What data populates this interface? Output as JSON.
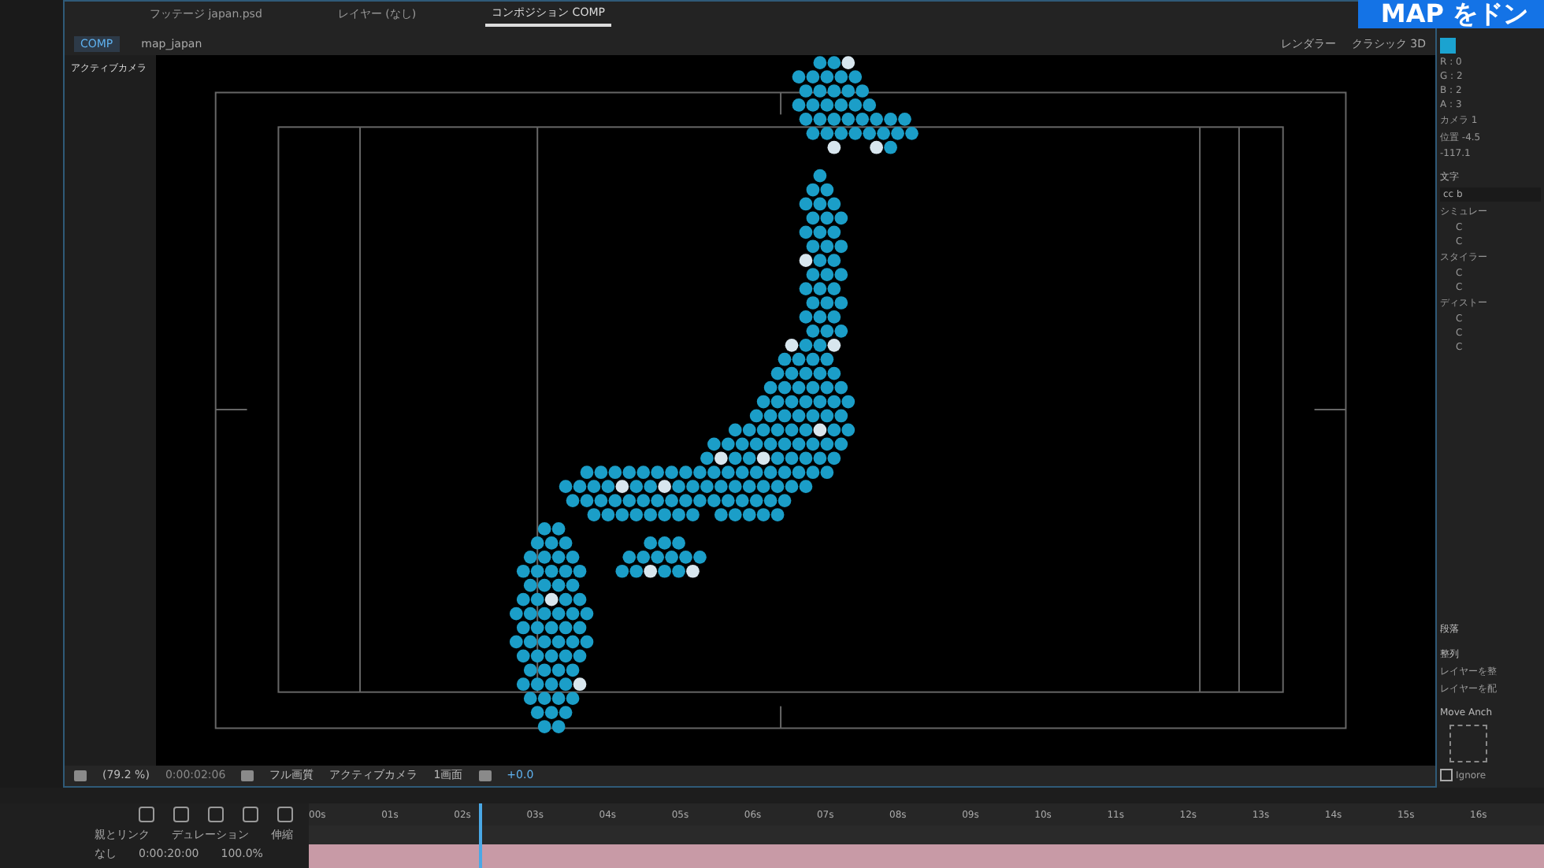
{
  "caption": "MAP をドン",
  "tabs": [
    {
      "label": "フッテージ japan.psd",
      "selected": false
    },
    {
      "label": "レイヤー (なし)",
      "selected": false
    },
    {
      "label": "コンポジション COMP",
      "selected": true
    }
  ],
  "breadcrumbs": [
    {
      "label": "COMP",
      "selected": true
    },
    {
      "label": "map_japan",
      "selected": false
    }
  ],
  "renderer": {
    "label": "レンダラー",
    "value": "クラシック 3D"
  },
  "camera_label": "アクティブカメラ",
  "viewer_toolbar": {
    "zoom": "(79.2 %)",
    "timecode": "0:00:02:06",
    "quality": "フル画質",
    "view": "アクティブカメラ",
    "layout": "1画面",
    "exposure": "+0.0"
  },
  "right_panel": {
    "color_values": [
      "R : 0",
      "G : 2",
      "B : 2",
      "A : 3"
    ],
    "camera": "カメラ 1",
    "position": "位置 -4.5",
    "position_z": "-117.1",
    "character_title": "文字",
    "search": "cc b",
    "groups": [
      {
        "label": "シミュレー",
        "items": [
          "C",
          "C"
        ]
      },
      {
        "label": "スタイラー",
        "items": [
          "C",
          "C"
        ]
      },
      {
        "label": "ディストー",
        "items": [
          "C",
          "C",
          "C"
        ]
      }
    ],
    "paragraph_title": "段落",
    "align_title": "整列",
    "align_layers": "レイヤーを整",
    "distribute_layers": "レイヤーを配",
    "move_anchor": "Move Anch",
    "ignore": {
      "label": "Ignore",
      "checked": false
    }
  },
  "timeline": {
    "columns": [
      "親とリンク",
      "デュレーション",
      "伸縮"
    ],
    "ruler": [
      "00s",
      "01s",
      "02s",
      "03s",
      "04s",
      "05s",
      "06s",
      "07s",
      "08s",
      "09s",
      "10s",
      "11s",
      "12s",
      "13s",
      "14s",
      "15s",
      "16s"
    ],
    "playhead": {
      "level": 0.143
    },
    "row": {
      "parent": "なし",
      "duration": "0:00:20:00",
      "stretch": "100.0%"
    }
  }
}
